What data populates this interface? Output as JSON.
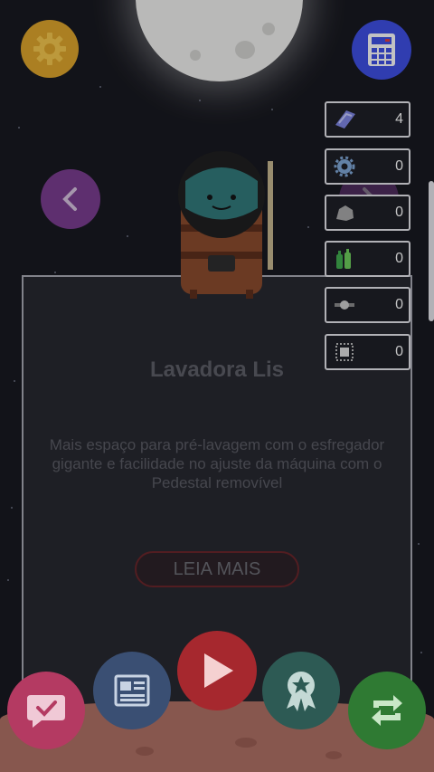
{
  "item": {
    "title": "Lavadora Lis",
    "description": "Mais espaço para pré-lavagem com o esfregador gigante e facilidade no ajuste da máquina com o Pedestal removível",
    "read_more_label": "LEIA MAIS"
  },
  "resources": [
    {
      "icon": "crystal-icon",
      "value": "4"
    },
    {
      "icon": "gear-icon",
      "value": "0"
    },
    {
      "icon": "rock-icon",
      "value": "0"
    },
    {
      "icon": "bottles-icon",
      "value": "0"
    },
    {
      "icon": "bolt-icon",
      "value": "0"
    },
    {
      "icon": "chip-icon",
      "value": "0"
    }
  ],
  "colors": {
    "settings": "#e0a628",
    "calculator": "#3d4ee6",
    "arrow": "#7a3b8f",
    "play": "#a6282e",
    "chat": "#b43a62",
    "news": "#3a4f73",
    "award": "#2d5a54",
    "exchange": "#2f7a33"
  },
  "icons": {
    "top_left": "settings-gear-icon",
    "top_right": "calculator-icon",
    "bottom": [
      "chat-check-icon",
      "newspaper-icon",
      "play-icon",
      "award-icon",
      "exchange-icon"
    ]
  }
}
